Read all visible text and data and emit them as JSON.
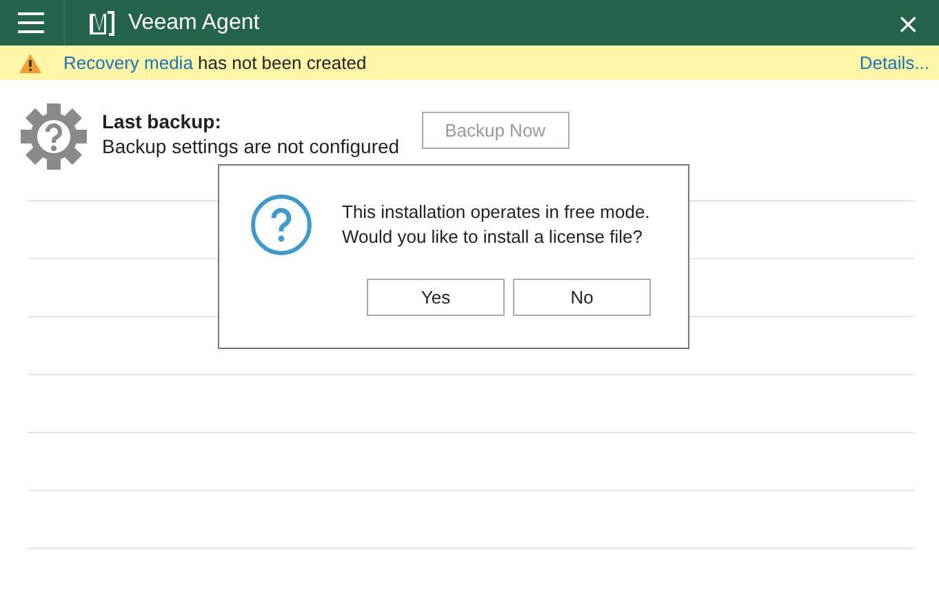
{
  "window": {
    "title": "Veeam Agent",
    "close": "×"
  },
  "notification": {
    "link": "Recovery media",
    "text": " has not been created",
    "details": "Details..."
  },
  "status": {
    "heading": "Last backup:",
    "text": "Backup settings are not configured",
    "button": {
      "label": "Backup Now",
      "disabled": true
    }
  },
  "dialog": {
    "message": [
      "This installation operates in free mode.",
      "Would you like to install a license file?"
    ],
    "buttons": [
      "Yes",
      "No"
    ]
  }
}
